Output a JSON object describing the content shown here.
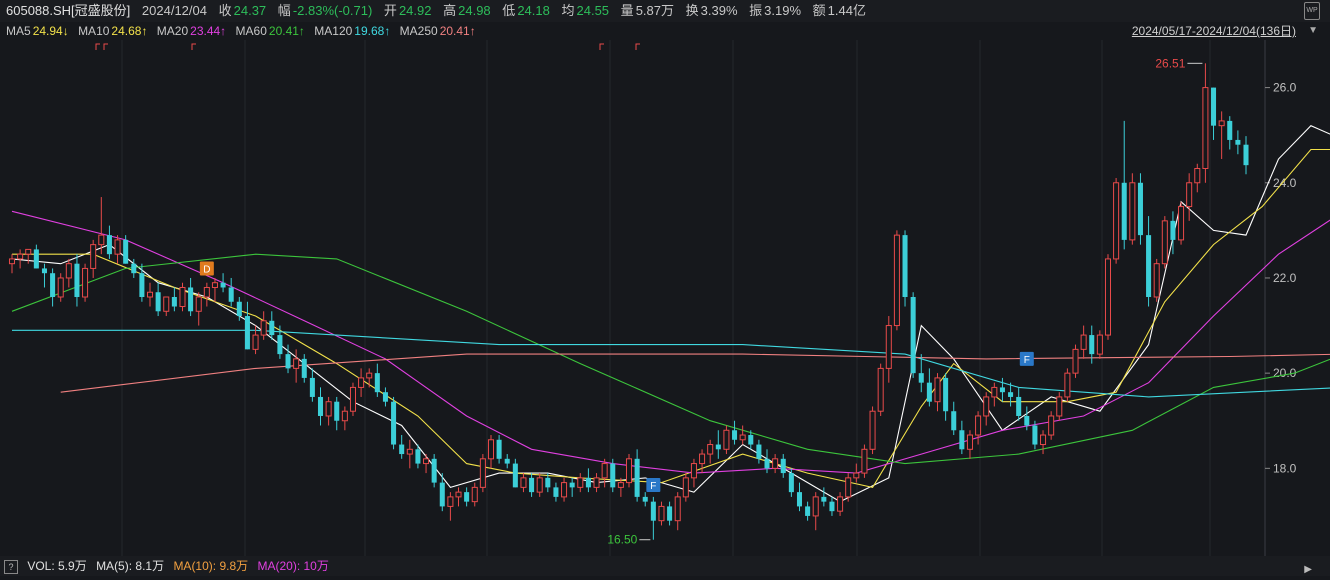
{
  "header": {
    "code": "605088.SH[冠盛股份]",
    "date": "2024/12/04",
    "close_label": "收",
    "close": "24.37",
    "chg_label": "幅",
    "chg": "-2.83%(-0.71)",
    "open_label": "开",
    "open": "24.92",
    "high_label": "高",
    "high": "24.98",
    "low_label": "低",
    "low": "24.18",
    "avg_label": "均",
    "avg": "24.55",
    "vol_label": "量",
    "vol": "5.87万",
    "turn_label": "换",
    "turn": "3.39%",
    "amp_label": "振",
    "amp": "3.19%",
    "amt_label": "额",
    "amt": "1.44亿",
    "wp_icon": "WP"
  },
  "ma_bar": {
    "ma5_label": "MA5",
    "ma5": "24.94↓",
    "ma10_label": "MA10",
    "ma10": "24.68↑",
    "ma20_label": "MA20",
    "ma20": "23.44↑",
    "ma60_label": "MA60",
    "ma60": "20.41↑",
    "ma120_label": "MA120",
    "ma120": "19.68↑",
    "ma250_label": "MA250",
    "ma250": "20.41↑",
    "range": "2024/05/17-2024/12/04(136日)"
  },
  "vol_bar": {
    "vol": "VOL: 5.9万",
    "ma5": "MA(5): 8.1万",
    "ma10": "MA(10): 9.8万",
    "ma20": "MA(20): 10万"
  },
  "colors": {
    "up": "#e84a4a",
    "down": "#3ccfd8",
    "ma5": "#ffffff",
    "ma10": "#f2e14a",
    "ma20": "#e040e0",
    "ma60": "#3cc43c",
    "ma120": "#40d8e0",
    "ma250": "#f08080"
  },
  "chart_data": {
    "type": "candlestick",
    "ylim": [
      16.2,
      27.0
    ],
    "yticks": [
      "18.0",
      "20.0",
      "22.0",
      "24.0",
      "26.0"
    ],
    "annotations": {
      "max_label": "26.51",
      "min_label": "16.50",
      "marker_d": "D",
      "marker_f": "F"
    },
    "ohlc": [
      [
        22.3,
        22.5,
        22.1,
        22.4
      ],
      [
        22.4,
        22.6,
        22.2,
        22.5
      ],
      [
        22.5,
        22.6,
        22.3,
        22.6
      ],
      [
        22.6,
        22.7,
        22.2,
        22.2
      ],
      [
        22.2,
        22.3,
        21.8,
        22.1
      ],
      [
        22.1,
        22.2,
        21.4,
        21.6
      ],
      [
        21.6,
        22.1,
        21.5,
        22.0
      ],
      [
        22.0,
        22.4,
        21.8,
        22.3
      ],
      [
        22.3,
        22.5,
        21.4,
        21.6
      ],
      [
        21.6,
        22.3,
        21.5,
        22.2
      ],
      [
        22.2,
        22.8,
        22.0,
        22.7
      ],
      [
        22.7,
        23.7,
        22.5,
        22.9
      ],
      [
        22.9,
        23.1,
        22.4,
        22.5
      ],
      [
        22.5,
        22.9,
        22.3,
        22.8
      ],
      [
        22.8,
        22.9,
        22.3,
        22.3
      ],
      [
        22.3,
        22.4,
        22.0,
        22.1
      ],
      [
        22.1,
        22.3,
        21.5,
        21.6
      ],
      [
        21.6,
        21.9,
        21.4,
        21.7
      ],
      [
        21.7,
        21.9,
        21.2,
        21.3
      ],
      [
        21.3,
        21.6,
        21.2,
        21.6
      ],
      [
        21.6,
        21.8,
        21.3,
        21.4
      ],
      [
        21.4,
        21.9,
        21.3,
        21.8
      ],
      [
        21.8,
        22.0,
        21.2,
        21.3
      ],
      [
        21.3,
        21.7,
        21.0,
        21.6
      ],
      [
        21.6,
        21.9,
        21.4,
        21.8
      ],
      [
        21.8,
        22.0,
        21.5,
        21.9
      ],
      [
        21.9,
        22.1,
        21.7,
        21.8
      ],
      [
        21.8,
        22.0,
        21.4,
        21.5
      ],
      [
        21.5,
        21.6,
        21.1,
        21.2
      ],
      [
        21.2,
        21.5,
        20.5,
        20.5
      ],
      [
        20.5,
        21.0,
        20.4,
        20.8
      ],
      [
        20.8,
        21.3,
        20.7,
        21.1
      ],
      [
        21.1,
        21.3,
        20.7,
        20.8
      ],
      [
        20.8,
        21.0,
        20.3,
        20.4
      ],
      [
        20.4,
        20.6,
        20.0,
        20.1
      ],
      [
        20.1,
        20.5,
        19.8,
        20.3
      ],
      [
        20.3,
        20.4,
        19.8,
        19.9
      ],
      [
        19.9,
        20.1,
        19.4,
        19.5
      ],
      [
        19.5,
        19.7,
        18.9,
        19.1
      ],
      [
        19.1,
        19.5,
        18.9,
        19.4
      ],
      [
        19.4,
        19.5,
        18.8,
        19.0
      ],
      [
        19.0,
        19.3,
        18.8,
        19.2
      ],
      [
        19.2,
        19.8,
        19.1,
        19.7
      ],
      [
        19.7,
        20.1,
        19.5,
        19.9
      ],
      [
        19.9,
        20.1,
        19.7,
        20.0
      ],
      [
        20.0,
        20.2,
        19.5,
        19.6
      ],
      [
        19.6,
        19.7,
        19.3,
        19.4
      ],
      [
        19.4,
        19.5,
        18.4,
        18.5
      ],
      [
        18.5,
        18.7,
        18.2,
        18.3
      ],
      [
        18.3,
        18.6,
        18.0,
        18.4
      ],
      [
        18.4,
        18.5,
        18.0,
        18.1
      ],
      [
        18.1,
        18.3,
        17.9,
        18.2
      ],
      [
        18.2,
        18.3,
        17.6,
        17.7
      ],
      [
        17.7,
        17.9,
        17.1,
        17.2
      ],
      [
        17.2,
        17.5,
        16.9,
        17.4
      ],
      [
        17.4,
        17.6,
        17.2,
        17.5
      ],
      [
        17.5,
        17.6,
        17.2,
        17.3
      ],
      [
        17.3,
        17.7,
        17.2,
        17.6
      ],
      [
        17.6,
        18.3,
        17.5,
        18.2
      ],
      [
        18.2,
        18.7,
        18.0,
        18.6
      ],
      [
        18.6,
        18.7,
        18.1,
        18.2
      ],
      [
        18.2,
        18.3,
        18.0,
        18.1
      ],
      [
        18.1,
        18.2,
        17.6,
        17.6
      ],
      [
        17.6,
        17.9,
        17.5,
        17.8
      ],
      [
        17.8,
        17.9,
        17.4,
        17.5
      ],
      [
        17.5,
        17.9,
        17.4,
        17.8
      ],
      [
        17.8,
        17.9,
        17.5,
        17.6
      ],
      [
        17.6,
        17.7,
        17.3,
        17.4
      ],
      [
        17.4,
        17.8,
        17.3,
        17.7
      ],
      [
        17.7,
        17.8,
        17.4,
        17.6
      ],
      [
        17.6,
        17.9,
        17.5,
        17.8
      ],
      [
        17.8,
        18.0,
        17.5,
        17.6
      ],
      [
        17.6,
        17.9,
        17.5,
        17.8
      ],
      [
        17.8,
        18.2,
        17.6,
        18.1
      ],
      [
        18.1,
        18.2,
        17.5,
        17.6
      ],
      [
        17.6,
        17.8,
        17.4,
        17.7
      ],
      [
        17.7,
        18.3,
        17.6,
        18.2
      ],
      [
        18.2,
        18.4,
        17.3,
        17.4
      ],
      [
        17.4,
        17.5,
        17.2,
        17.3
      ],
      [
        17.3,
        17.4,
        16.5,
        16.9
      ],
      [
        16.9,
        17.3,
        16.8,
        17.2
      ],
      [
        17.2,
        17.3,
        16.8,
        16.9
      ],
      [
        16.9,
        17.5,
        16.7,
        17.4
      ],
      [
        17.4,
        17.9,
        17.3,
        17.8
      ],
      [
        17.8,
        18.2,
        17.6,
        18.1
      ],
      [
        18.1,
        18.4,
        17.9,
        18.3
      ],
      [
        18.3,
        18.6,
        18.1,
        18.5
      ],
      [
        18.5,
        18.8,
        18.2,
        18.4
      ],
      [
        18.4,
        18.9,
        18.3,
        18.8
      ],
      [
        18.8,
        19.0,
        18.5,
        18.6
      ],
      [
        18.6,
        18.9,
        18.5,
        18.7
      ],
      [
        18.7,
        18.8,
        18.4,
        18.5
      ],
      [
        18.5,
        18.6,
        18.1,
        18.2
      ],
      [
        18.2,
        18.4,
        17.9,
        18.0
      ],
      [
        18.0,
        18.3,
        17.9,
        18.2
      ],
      [
        18.2,
        18.3,
        17.8,
        17.9
      ],
      [
        17.9,
        18.0,
        17.4,
        17.5
      ],
      [
        17.5,
        17.7,
        17.1,
        17.2
      ],
      [
        17.2,
        17.3,
        16.9,
        17.0
      ],
      [
        17.0,
        17.5,
        16.7,
        17.4
      ],
      [
        17.4,
        17.6,
        17.2,
        17.3
      ],
      [
        17.3,
        17.4,
        17.0,
        17.1
      ],
      [
        17.1,
        17.5,
        17.0,
        17.4
      ],
      [
        17.4,
        17.9,
        17.3,
        17.8
      ],
      [
        17.8,
        18.1,
        17.7,
        17.9
      ],
      [
        17.9,
        18.5,
        17.8,
        18.4
      ],
      [
        18.4,
        19.3,
        18.3,
        19.2
      ],
      [
        19.2,
        20.2,
        19.1,
        20.1
      ],
      [
        20.1,
        21.2,
        19.8,
        21.0
      ],
      [
        21.0,
        23.0,
        20.9,
        22.9
      ],
      [
        22.9,
        23.0,
        21.4,
        21.6
      ],
      [
        21.6,
        21.7,
        19.9,
        20.0
      ],
      [
        20.0,
        20.4,
        19.6,
        19.8
      ],
      [
        19.8,
        20.1,
        19.3,
        19.4
      ],
      [
        19.4,
        20.0,
        19.2,
        19.9
      ],
      [
        19.9,
        20.0,
        19.0,
        19.2
      ],
      [
        19.2,
        19.4,
        18.7,
        18.8
      ],
      [
        18.8,
        19.0,
        18.3,
        18.4
      ],
      [
        18.4,
        18.8,
        18.2,
        18.7
      ],
      [
        18.7,
        19.2,
        18.5,
        19.1
      ],
      [
        19.1,
        19.6,
        18.9,
        19.5
      ],
      [
        19.5,
        19.8,
        19.3,
        19.7
      ],
      [
        19.7,
        19.9,
        19.4,
        19.6
      ],
      [
        19.6,
        19.8,
        19.3,
        19.5
      ],
      [
        19.5,
        19.7,
        19.0,
        19.1
      ],
      [
        19.1,
        19.3,
        18.8,
        18.9
      ],
      [
        18.9,
        19.0,
        18.4,
        18.5
      ],
      [
        18.5,
        18.8,
        18.3,
        18.7
      ],
      [
        18.7,
        19.2,
        18.6,
        19.1
      ],
      [
        19.1,
        19.6,
        19.0,
        19.5
      ],
      [
        19.5,
        20.1,
        19.4,
        20.0
      ],
      [
        20.0,
        20.6,
        19.9,
        20.5
      ],
      [
        20.5,
        21.0,
        20.3,
        20.8
      ],
      [
        20.8,
        21.0,
        20.2,
        20.4
      ],
      [
        20.4,
        20.9,
        20.3,
        20.8
      ],
      [
        20.8,
        22.5,
        20.7,
        22.4
      ],
      [
        22.4,
        24.1,
        22.3,
        24.0
      ],
      [
        24.0,
        25.3,
        22.6,
        22.8
      ],
      [
        22.8,
        24.2,
        22.7,
        24.0
      ],
      [
        24.0,
        24.2,
        22.7,
        22.9
      ],
      [
        22.9,
        23.3,
        21.4,
        21.6
      ],
      [
        21.6,
        22.4,
        21.5,
        22.3
      ],
      [
        22.3,
        23.3,
        22.2,
        23.2
      ],
      [
        23.2,
        23.4,
        22.5,
        22.8
      ],
      [
        22.8,
        23.6,
        22.7,
        23.5
      ],
      [
        23.5,
        24.2,
        23.2,
        24.0
      ],
      [
        24.0,
        24.4,
        23.8,
        24.3
      ],
      [
        24.3,
        26.51,
        24.0,
        26.0
      ],
      [
        26.0,
        26.0,
        24.9,
        25.2
      ],
      [
        25.2,
        25.5,
        24.5,
        25.3
      ],
      [
        25.3,
        25.4,
        24.7,
        24.9
      ],
      [
        24.9,
        25.1,
        24.6,
        24.8
      ],
      [
        24.8,
        24.98,
        24.18,
        24.37
      ]
    ],
    "ma": {
      "ma5": [
        [
          0,
          22.4
        ],
        [
          6,
          22.3
        ],
        [
          12,
          22.7
        ],
        [
          18,
          21.9
        ],
        [
          24,
          21.6
        ],
        [
          30,
          21.0
        ],
        [
          36,
          20.2
        ],
        [
          42,
          19.4
        ],
        [
          48,
          18.9
        ],
        [
          54,
          17.6
        ],
        [
          60,
          17.9
        ],
        [
          66,
          17.9
        ],
        [
          72,
          17.7
        ],
        [
          78,
          17.8
        ],
        [
          84,
          17.5
        ],
        [
          90,
          18.5
        ],
        [
          96,
          17.9
        ],
        [
          102,
          17.3
        ],
        [
          108,
          17.8
        ],
        [
          112,
          21.0
        ],
        [
          116,
          20.3
        ],
        [
          122,
          18.8
        ],
        [
          128,
          19.5
        ],
        [
          134,
          19.2
        ],
        [
          140,
          20.6
        ],
        [
          144,
          23.6
        ],
        [
          148,
          23.0
        ],
        [
          152,
          22.9
        ],
        [
          156,
          24.5
        ],
        [
          160,
          25.2
        ],
        [
          164,
          24.9
        ]
      ],
      "ma10": [
        [
          0,
          22.5
        ],
        [
          10,
          22.5
        ],
        [
          20,
          21.8
        ],
        [
          30,
          21.2
        ],
        [
          40,
          20.2
        ],
        [
          50,
          19.1
        ],
        [
          56,
          18.1
        ],
        [
          62,
          17.9
        ],
        [
          70,
          17.8
        ],
        [
          80,
          17.7
        ],
        [
          90,
          18.3
        ],
        [
          98,
          17.9
        ],
        [
          106,
          17.6
        ],
        [
          112,
          19.3
        ],
        [
          116,
          20.2
        ],
        [
          122,
          19.4
        ],
        [
          130,
          19.4
        ],
        [
          136,
          19.6
        ],
        [
          142,
          21.5
        ],
        [
          148,
          22.7
        ],
        [
          154,
          23.5
        ],
        [
          160,
          24.7
        ],
        [
          164,
          24.7
        ]
      ],
      "ma20": [
        [
          0,
          23.4
        ],
        [
          14,
          22.8
        ],
        [
          26,
          21.9
        ],
        [
          36,
          21.1
        ],
        [
          46,
          20.3
        ],
        [
          56,
          19.1
        ],
        [
          64,
          18.4
        ],
        [
          74,
          18.1
        ],
        [
          84,
          17.9
        ],
        [
          94,
          18.0
        ],
        [
          104,
          17.9
        ],
        [
          112,
          18.3
        ],
        [
          122,
          18.8
        ],
        [
          132,
          19.1
        ],
        [
          140,
          19.8
        ],
        [
          148,
          21.2
        ],
        [
          156,
          22.5
        ],
        [
          164,
          23.4
        ]
      ],
      "ma60": [
        [
          0,
          21.3
        ],
        [
          14,
          22.2
        ],
        [
          30,
          22.5
        ],
        [
          40,
          22.4
        ],
        [
          56,
          21.3
        ],
        [
          70,
          20.2
        ],
        [
          86,
          19.0
        ],
        [
          98,
          18.4
        ],
        [
          110,
          18.1
        ],
        [
          124,
          18.3
        ],
        [
          138,
          18.8
        ],
        [
          148,
          19.7
        ],
        [
          158,
          20.0
        ],
        [
          164,
          20.4
        ]
      ],
      "ma120": [
        [
          0,
          20.9
        ],
        [
          30,
          20.9
        ],
        [
          60,
          20.6
        ],
        [
          90,
          20.6
        ],
        [
          110,
          20.4
        ],
        [
          124,
          19.7
        ],
        [
          140,
          19.5
        ],
        [
          164,
          19.7
        ]
      ],
      "ma250": [
        [
          6,
          19.6
        ],
        [
          30,
          20.1
        ],
        [
          56,
          20.4
        ],
        [
          90,
          20.4
        ],
        [
          120,
          20.3
        ],
        [
          150,
          20.35
        ],
        [
          164,
          20.4
        ]
      ]
    }
  }
}
